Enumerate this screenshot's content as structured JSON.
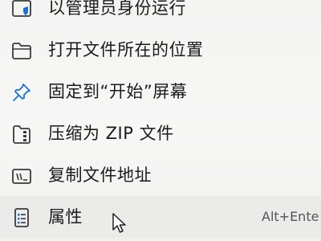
{
  "context_menu": {
    "items": [
      {
        "label": "以管理员身份运行",
        "icon": "shield-icon"
      },
      {
        "label": "打开文件所在的位置",
        "icon": "folder-icon"
      },
      {
        "label": "固定到“开始”屏幕",
        "icon": "pin-icon"
      },
      {
        "label": "压缩为 ZIP 文件",
        "icon": "zip-folder-icon"
      },
      {
        "label": "复制文件地址",
        "icon": "copy-path-icon"
      },
      {
        "label": "属性",
        "icon": "properties-icon",
        "shortcut": "Alt+Ente"
      }
    ],
    "accent_color": "#1e6fd9"
  }
}
